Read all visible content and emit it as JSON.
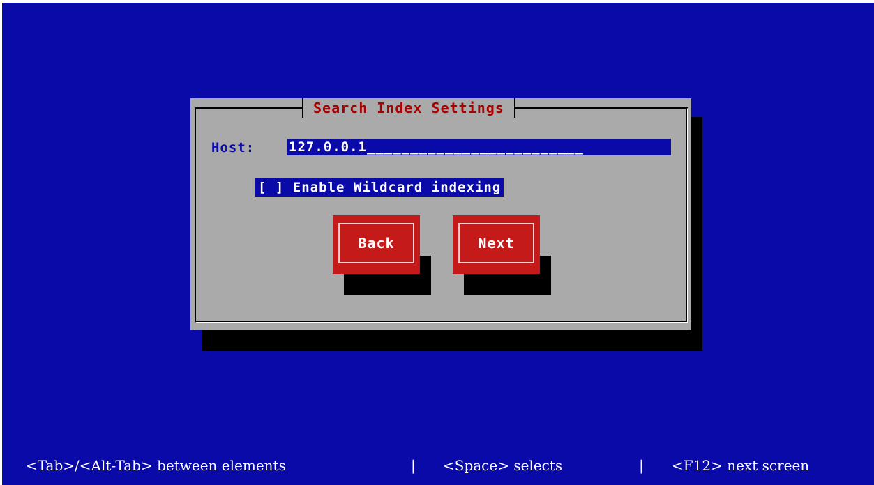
{
  "dialog": {
    "title": "Search Index Settings",
    "host_label": "Host:",
    "host_value": "127.0.0.1",
    "host_field_fill": "_________________________",
    "wildcard_checkbox": {
      "label": "[ ] Enable Wildcard indexing",
      "checked": false
    },
    "buttons": {
      "back_label": "Back",
      "next_label": "Next"
    }
  },
  "help_bar": {
    "item1": "<Tab>/<Alt-Tab> between elements",
    "sep": "|",
    "item2": "<Space> selects",
    "item3": "<F12> next screen"
  },
  "colors": {
    "background": "#0a0aa8",
    "dialog": "#aaaaaa",
    "title": "#aa0000",
    "button": "#c41a1a",
    "shadow": "#000000"
  }
}
